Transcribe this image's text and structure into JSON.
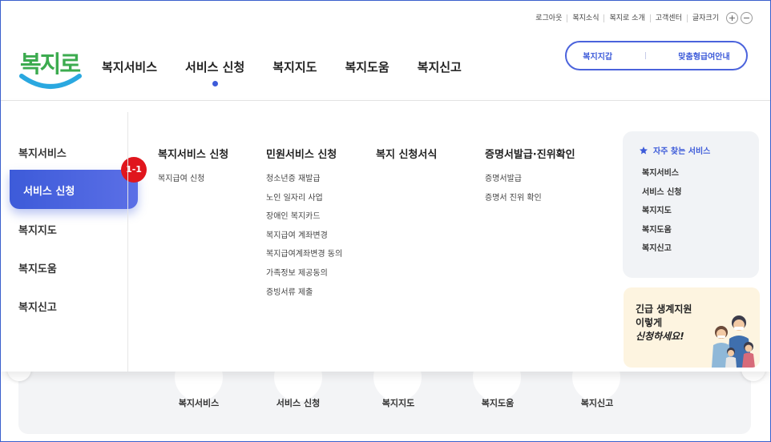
{
  "utility": {
    "links": [
      "로그아웃",
      "복지소식",
      "복지로 소개",
      "고객센터",
      "글자크기"
    ],
    "font_plus": "+",
    "font_minus": "−"
  },
  "logo": {
    "text": "복지로"
  },
  "gnb": {
    "items": [
      "복지서비스",
      "서비스 신청",
      "복지지도",
      "복지도움",
      "복지신고"
    ],
    "active_index": 1
  },
  "quick": {
    "left": "복지지갑",
    "right": "맞춤형급여안내"
  },
  "side_menu": {
    "items": [
      "복지서비스",
      "서비스 신청",
      "복지지도",
      "복지도움",
      "복지신고"
    ],
    "active_index": 1
  },
  "badge": "1-1",
  "columns": [
    {
      "title": "복지서비스 신청",
      "items": [
        "복지급여 신청"
      ]
    },
    {
      "title": "민원서비스 신청",
      "items": [
        "청소년증 재발급",
        "노인 일자리 사업",
        "장애인 복지카드",
        "복지급여 계좌변경",
        "복지급여계좌변경 동의",
        "가족정보 제공동의",
        "증빙서류 제출"
      ]
    },
    {
      "title": "복지 신청서식",
      "items": []
    },
    {
      "title": "증명서발급·진위확인",
      "items": [
        "증명서발급",
        "증명서 진위 확인"
      ]
    }
  ],
  "favorites": {
    "title": "자주 찾는 서비스",
    "items": [
      "복지서비스",
      "서비스 신청",
      "복지지도",
      "복지도움",
      "복지신고"
    ]
  },
  "banner": {
    "lines": [
      "긴급 생계지원",
      "이렇게",
      "신청하세요!"
    ]
  },
  "bottom_menu": {
    "items": [
      "복지서비스",
      "서비스 신청",
      "복지지도",
      "복지도움",
      "복지신고"
    ]
  },
  "colors": {
    "primary": "#3d5bd9",
    "logo_green": "#3cab4f",
    "logo_blue": "#2aa8e0",
    "badge_red": "#e0161d",
    "banner_bg": "#fdf4e0"
  }
}
